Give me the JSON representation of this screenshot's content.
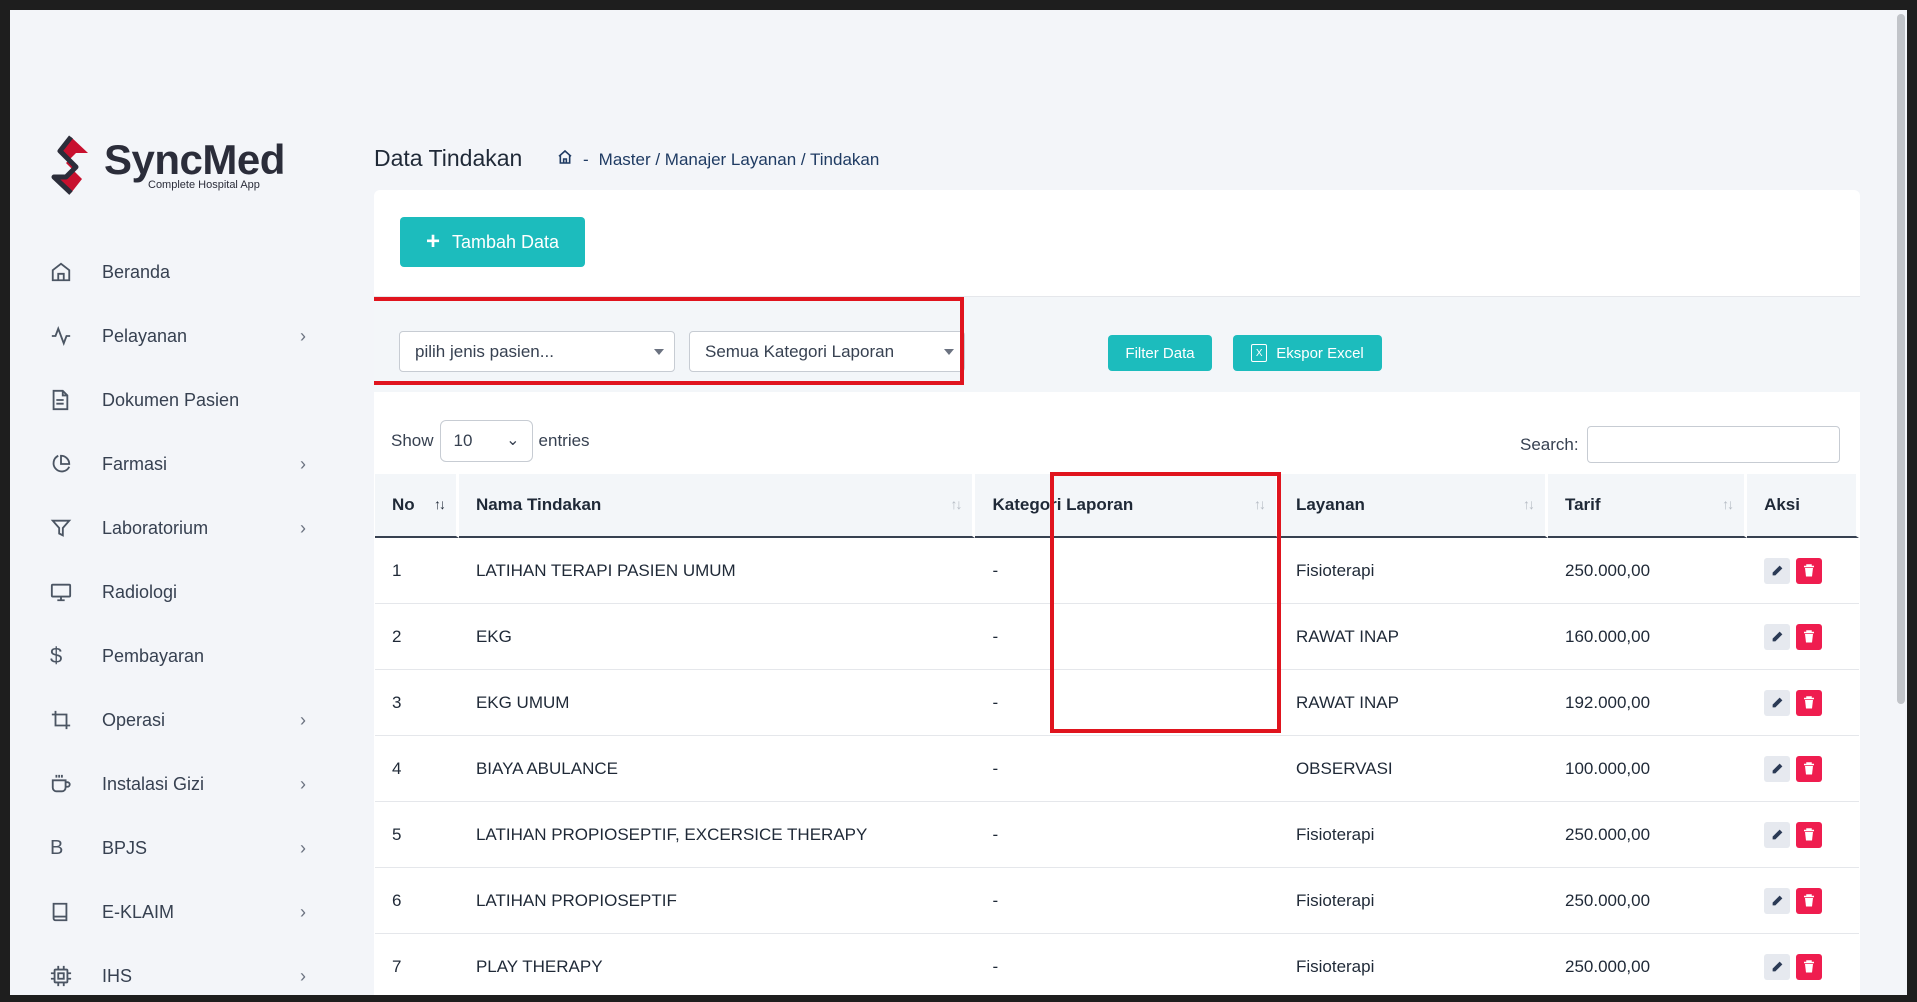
{
  "brand": {
    "name": "SyncMed",
    "tagline": "Complete Hospital App"
  },
  "colors": {
    "accent": "#1cbcbd",
    "danger": "#ef1d4f",
    "highlight": "#e0141e"
  },
  "sidebar": {
    "items": [
      {
        "label": "Beranda",
        "icon": "home-icon",
        "has_children": false
      },
      {
        "label": "Pelayanan",
        "icon": "activity-icon",
        "has_children": true
      },
      {
        "label": "Dokumen Pasien",
        "icon": "document-icon",
        "has_children": false
      },
      {
        "label": "Farmasi",
        "icon": "pie-chart-icon",
        "has_children": true
      },
      {
        "label": "Laboratorium",
        "icon": "filter-icon",
        "has_children": true
      },
      {
        "label": "Radiologi",
        "icon": "monitor-icon",
        "has_children": false
      },
      {
        "label": "Pembayaran",
        "icon": "dollar-icon",
        "has_children": false
      },
      {
        "label": "Operasi",
        "icon": "crop-icon",
        "has_children": true
      },
      {
        "label": "Instalasi Gizi",
        "icon": "cup-icon",
        "has_children": true
      },
      {
        "label": "BPJS",
        "icon": "letter-b-icon",
        "has_children": true
      },
      {
        "label": "E-KLAIM",
        "icon": "book-icon",
        "has_children": true
      },
      {
        "label": "IHS",
        "icon": "chip-icon",
        "has_children": true
      }
    ]
  },
  "header": {
    "title": "Data Tindakan",
    "breadcrumb_sep": "-",
    "breadcrumb": "Master / Manajer Layanan / Tindakan"
  },
  "toolbar": {
    "add_label": "Tambah Data",
    "add_icon": "plus-icon"
  },
  "filters": {
    "patient_type": "pilih jenis pasien...",
    "report_category": "Semua Kategori Laporan",
    "filter_label": "Filter Data",
    "export_label": "Ekspor Excel"
  },
  "table_controls": {
    "show_label": "Show",
    "page_length": "10",
    "entries_label": "entries",
    "search_label": "Search:"
  },
  "table": {
    "columns": [
      "No",
      "Nama Tindakan",
      "Kategori Laporan",
      "Layanan",
      "Tarif",
      "Aksi"
    ],
    "rows": [
      {
        "no": "1",
        "nama": "LATIHAN TERAPI PASIEN UMUM",
        "kategori": "-",
        "layanan": "Fisioterapi",
        "tarif": "250.000,00"
      },
      {
        "no": "2",
        "nama": "EKG",
        "kategori": "-",
        "layanan": "RAWAT INAP",
        "tarif": "160.000,00"
      },
      {
        "no": "3",
        "nama": "EKG UMUM",
        "kategori": "-",
        "layanan": "RAWAT INAP",
        "tarif": "192.000,00"
      },
      {
        "no": "4",
        "nama": "BIAYA ABULANCE",
        "kategori": "-",
        "layanan": "OBSERVASI",
        "tarif": "100.000,00"
      },
      {
        "no": "5",
        "nama": "LATIHAN PROPIOSEPTIF, EXCERSICE THERAPY",
        "kategori": "-",
        "layanan": "Fisioterapi",
        "tarif": "250.000,00"
      },
      {
        "no": "6",
        "nama": "LATIHAN PROPIOSEPTIF",
        "kategori": "-",
        "layanan": "Fisioterapi",
        "tarif": "250.000,00"
      },
      {
        "no": "7",
        "nama": "PLAY THERAPY",
        "kategori": "-",
        "layanan": "Fisioterapi",
        "tarif": "250.000,00"
      }
    ]
  }
}
